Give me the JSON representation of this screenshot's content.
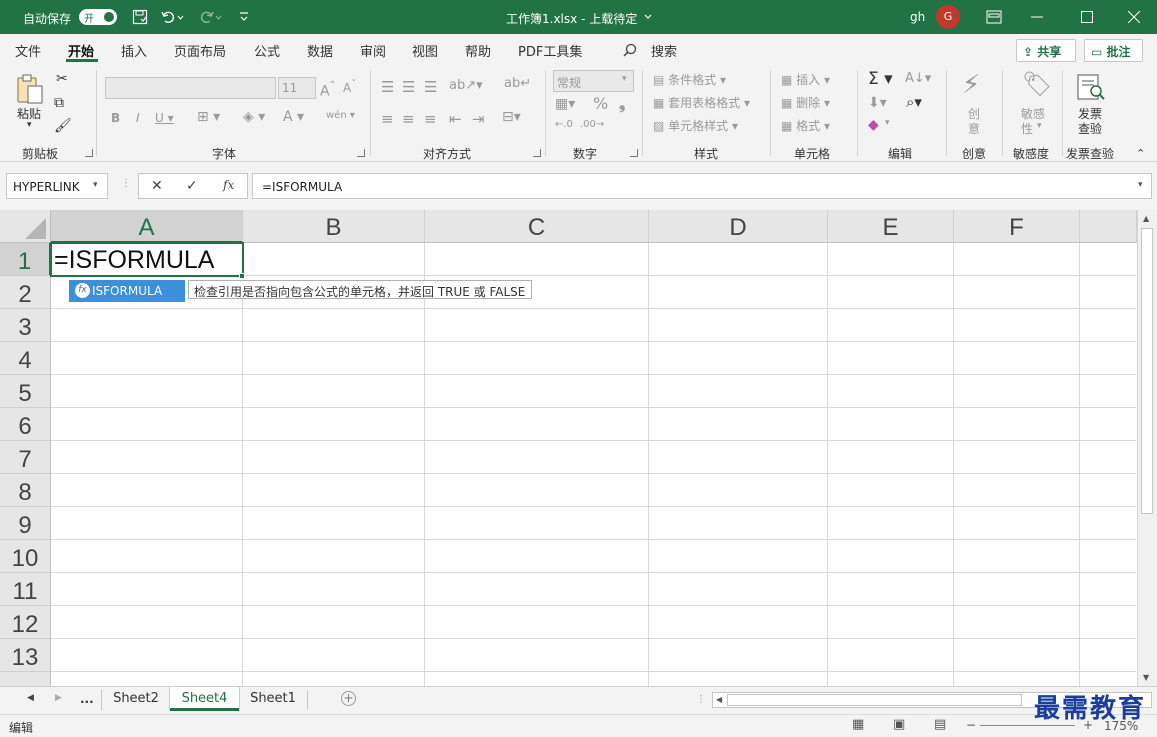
{
  "titlebar": {
    "autosave_label": "自动保存",
    "autosave_state": "开",
    "doc_title": "工作簿1.xlsx - 上载待定",
    "user_initials": "gh",
    "avatar_letter": "G"
  },
  "menu": {
    "items": [
      "文件",
      "开始",
      "插入",
      "页面布局",
      "公式",
      "数据",
      "审阅",
      "视图",
      "帮助",
      "PDF工具集"
    ],
    "search_label": "搜索",
    "share_label": "共享",
    "comments_label": "批注"
  },
  "ribbon": {
    "clipboard": {
      "paste_label": "粘贴",
      "group_label": "剪贴板"
    },
    "font": {
      "font_size": "11",
      "group_label": "字体"
    },
    "alignment": {
      "group_label": "对齐方式"
    },
    "number": {
      "format_value": "常规",
      "group_label": "数字"
    },
    "styles": {
      "conditional": "条件格式",
      "table_format": "套用表格格式",
      "cell_styles": "单元格样式",
      "group_label": "样式"
    },
    "cells": {
      "insert": "插入",
      "delete": "删除",
      "format": "格式",
      "group_label": "单元格"
    },
    "editing": {
      "group_label": "编辑"
    },
    "ideas": {
      "button_label_1": "创",
      "button_label_2": "意",
      "group_label": "创意"
    },
    "sensitivity": {
      "button_label_1": "敏感",
      "button_label_2": "性",
      "group_label": "敏感度"
    },
    "invoice": {
      "button_label_1": "发票",
      "button_label_2": "查验",
      "group_label": "发票查验"
    }
  },
  "formula_bar": {
    "name_box": "HYPERLINK",
    "fx_label": "fx",
    "formula": "=ISFORMULA"
  },
  "grid": {
    "columns": [
      "A",
      "B",
      "C",
      "D",
      "E",
      "F"
    ],
    "rows": [
      "1",
      "2",
      "3",
      "4",
      "5",
      "6",
      "7",
      "8",
      "9",
      "10",
      "11",
      "12",
      "13"
    ],
    "active_cell_text": "=ISFORMULA",
    "autocomplete_item": "ISFORMULA",
    "autocomplete_icon": "fx",
    "tooltip": "检查引用是否指向包含公式的单元格，并返回 TRUE 或 FALSE"
  },
  "sheets": {
    "ellipsis": "...",
    "tabs": [
      "Sheet2",
      "Sheet4",
      "Sheet1"
    ],
    "active_index": 1
  },
  "status": {
    "mode": "编辑",
    "zoom": "175%"
  },
  "watermark": "最需教育",
  "colors": {
    "accent": "#217346",
    "autocomplete_bg": "#3b8fdb",
    "avatar": "#c0392b"
  }
}
